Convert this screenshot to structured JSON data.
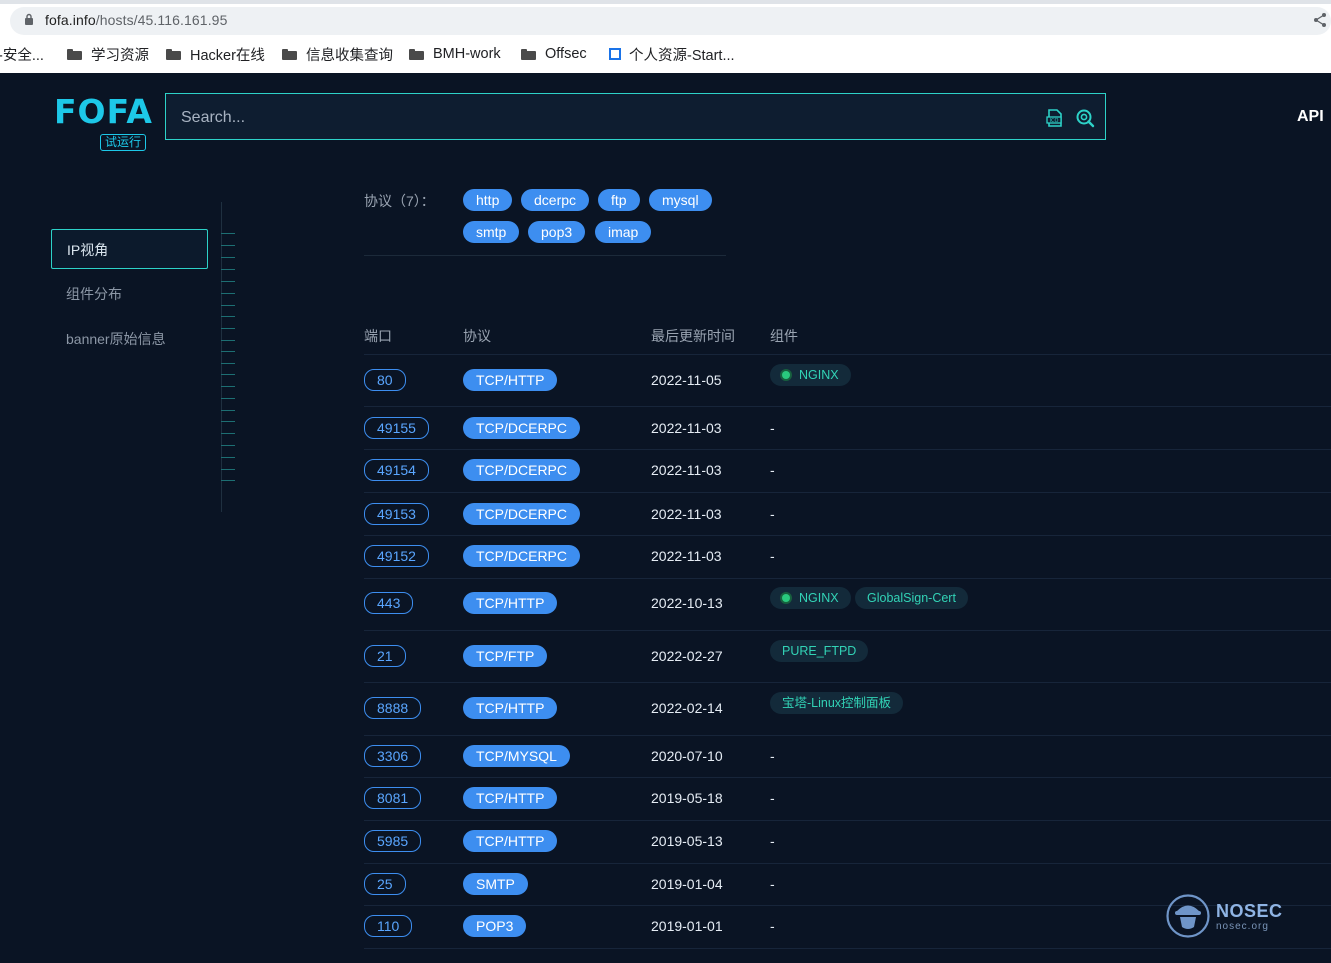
{
  "browser": {
    "url_host": "fofa.info",
    "url_path": "/hosts/45.116.161.95",
    "bookmarks": [
      {
        "label": "-安全...",
        "icon": "none"
      },
      {
        "label": "学习资源",
        "icon": "folder-icon"
      },
      {
        "label": "Hacker在线",
        "icon": "folder-icon"
      },
      {
        "label": "信息收集查询",
        "icon": "folder-icon"
      },
      {
        "label": "BMH-work",
        "icon": "folder-icon"
      },
      {
        "label": "Offsec",
        "icon": "folder-icon"
      },
      {
        "label": "个人资源-Start...",
        "icon": "bookmark-site-icon"
      }
    ]
  },
  "header": {
    "logo_text": "FOFA",
    "logo_badge": "试运行",
    "search_placeholder": "Search...",
    "api_label": "API"
  },
  "sidebar": {
    "items": [
      {
        "label": "IP视角",
        "active": true
      },
      {
        "label": "组件分布",
        "active": false
      },
      {
        "label": "banner原始信息",
        "active": false
      }
    ]
  },
  "protocols": {
    "label": "协议（7）：",
    "items": [
      "http",
      "dcerpc",
      "ftp",
      "mysql",
      "smtp",
      "pop3",
      "imap"
    ]
  },
  "table": {
    "headers": {
      "port": "端口",
      "protocol": "协议",
      "updated": "最后更新时间",
      "component": "组件"
    },
    "rows": [
      {
        "port": "80",
        "protocol": "TCP/HTTP",
        "date": "2022-11-05",
        "components": [
          "NGINX"
        ],
        "dash": ""
      },
      {
        "port": "49155",
        "protocol": "TCP/DCERPC",
        "date": "2022-11-03",
        "components": [],
        "dash": "-"
      },
      {
        "port": "49154",
        "protocol": "TCP/DCERPC",
        "date": "2022-11-03",
        "components": [],
        "dash": "-"
      },
      {
        "port": "49153",
        "protocol": "TCP/DCERPC",
        "date": "2022-11-03",
        "components": [],
        "dash": "-"
      },
      {
        "port": "49152",
        "protocol": "TCP/DCERPC",
        "date": "2022-11-03",
        "components": [],
        "dash": "-"
      },
      {
        "port": "443",
        "protocol": "TCP/HTTP",
        "date": "2022-10-13",
        "components": [
          "NGINX",
          "GlobalSign-Cert"
        ],
        "dash": ""
      },
      {
        "port": "21",
        "protocol": "TCP/FTP",
        "date": "2022-02-27",
        "components": [
          "PURE_FTPD"
        ],
        "dash": ""
      },
      {
        "port": "8888",
        "protocol": "TCP/HTTP",
        "date": "2022-02-14",
        "components": [
          "宝塔-Linux控制面板"
        ],
        "dash": ""
      },
      {
        "port": "3306",
        "protocol": "TCP/MYSQL",
        "date": "2020-07-10",
        "components": [],
        "dash": "-"
      },
      {
        "port": "8081",
        "protocol": "TCP/HTTP",
        "date": "2019-05-18",
        "components": [],
        "dash": "-"
      },
      {
        "port": "5985",
        "protocol": "TCP/HTTP",
        "date": "2019-05-13",
        "components": [],
        "dash": "-"
      },
      {
        "port": "25",
        "protocol": "SMTP",
        "date": "2019-01-04",
        "components": [],
        "dash": "-"
      },
      {
        "port": "110",
        "protocol": "POP3",
        "date": "2019-01-01",
        "components": [],
        "dash": "-"
      }
    ]
  },
  "watermark": {
    "name": "NOSEC",
    "domain": "nosec.org"
  },
  "colors": {
    "accent": "#3d8ef0",
    "teal": "#2dd2c8",
    "background": "#0a1424",
    "component_text": "#32d3b6",
    "nginx_dot": "#29c97d"
  }
}
